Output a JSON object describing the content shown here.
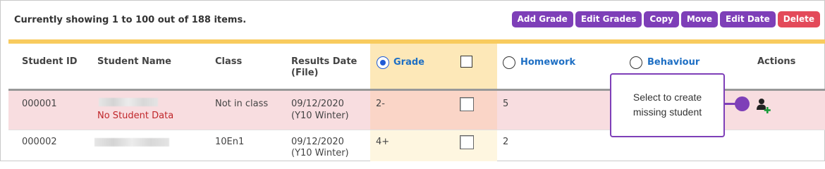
{
  "status": {
    "showing_text": "Currently showing 1 to 100 out of 188 items."
  },
  "toolbar": {
    "add_grade": "Add Grade",
    "edit_grades": "Edit Grades",
    "copy": "Copy",
    "move": "Move",
    "edit_date": "Edit Date",
    "delete": "Delete"
  },
  "table": {
    "headers": {
      "student_id": "Student ID",
      "student_name": "Student Name",
      "class": "Class",
      "results_date_line1": "Results Date",
      "results_date_line2": "(File)",
      "grade": "Grade",
      "homework": "Homework",
      "behaviour": "Behaviour",
      "actions": "Actions"
    },
    "rows": [
      {
        "student_id": "000001",
        "name_note": "No Student Data",
        "class": "Not in class",
        "date": "09/12/2020",
        "date_file": "(Y10 Winter)",
        "grade": "2-",
        "homework": "5"
      },
      {
        "student_id": "000002",
        "class": "10En1",
        "date": "09/12/2020",
        "date_file": "(Y10 Winter)",
        "grade": "4+",
        "homework": "2"
      }
    ]
  },
  "tooltip": {
    "line1": "Select to create",
    "line2": "missing student"
  },
  "colors": {
    "accent": "#7e3fb8",
    "danger": "#e34a5a",
    "header_bar": "#f8cb5e",
    "error_row": "#f8dde0",
    "link_blue": "#1e6fc4"
  },
  "icons": {
    "row_action": "add-user-icon"
  }
}
